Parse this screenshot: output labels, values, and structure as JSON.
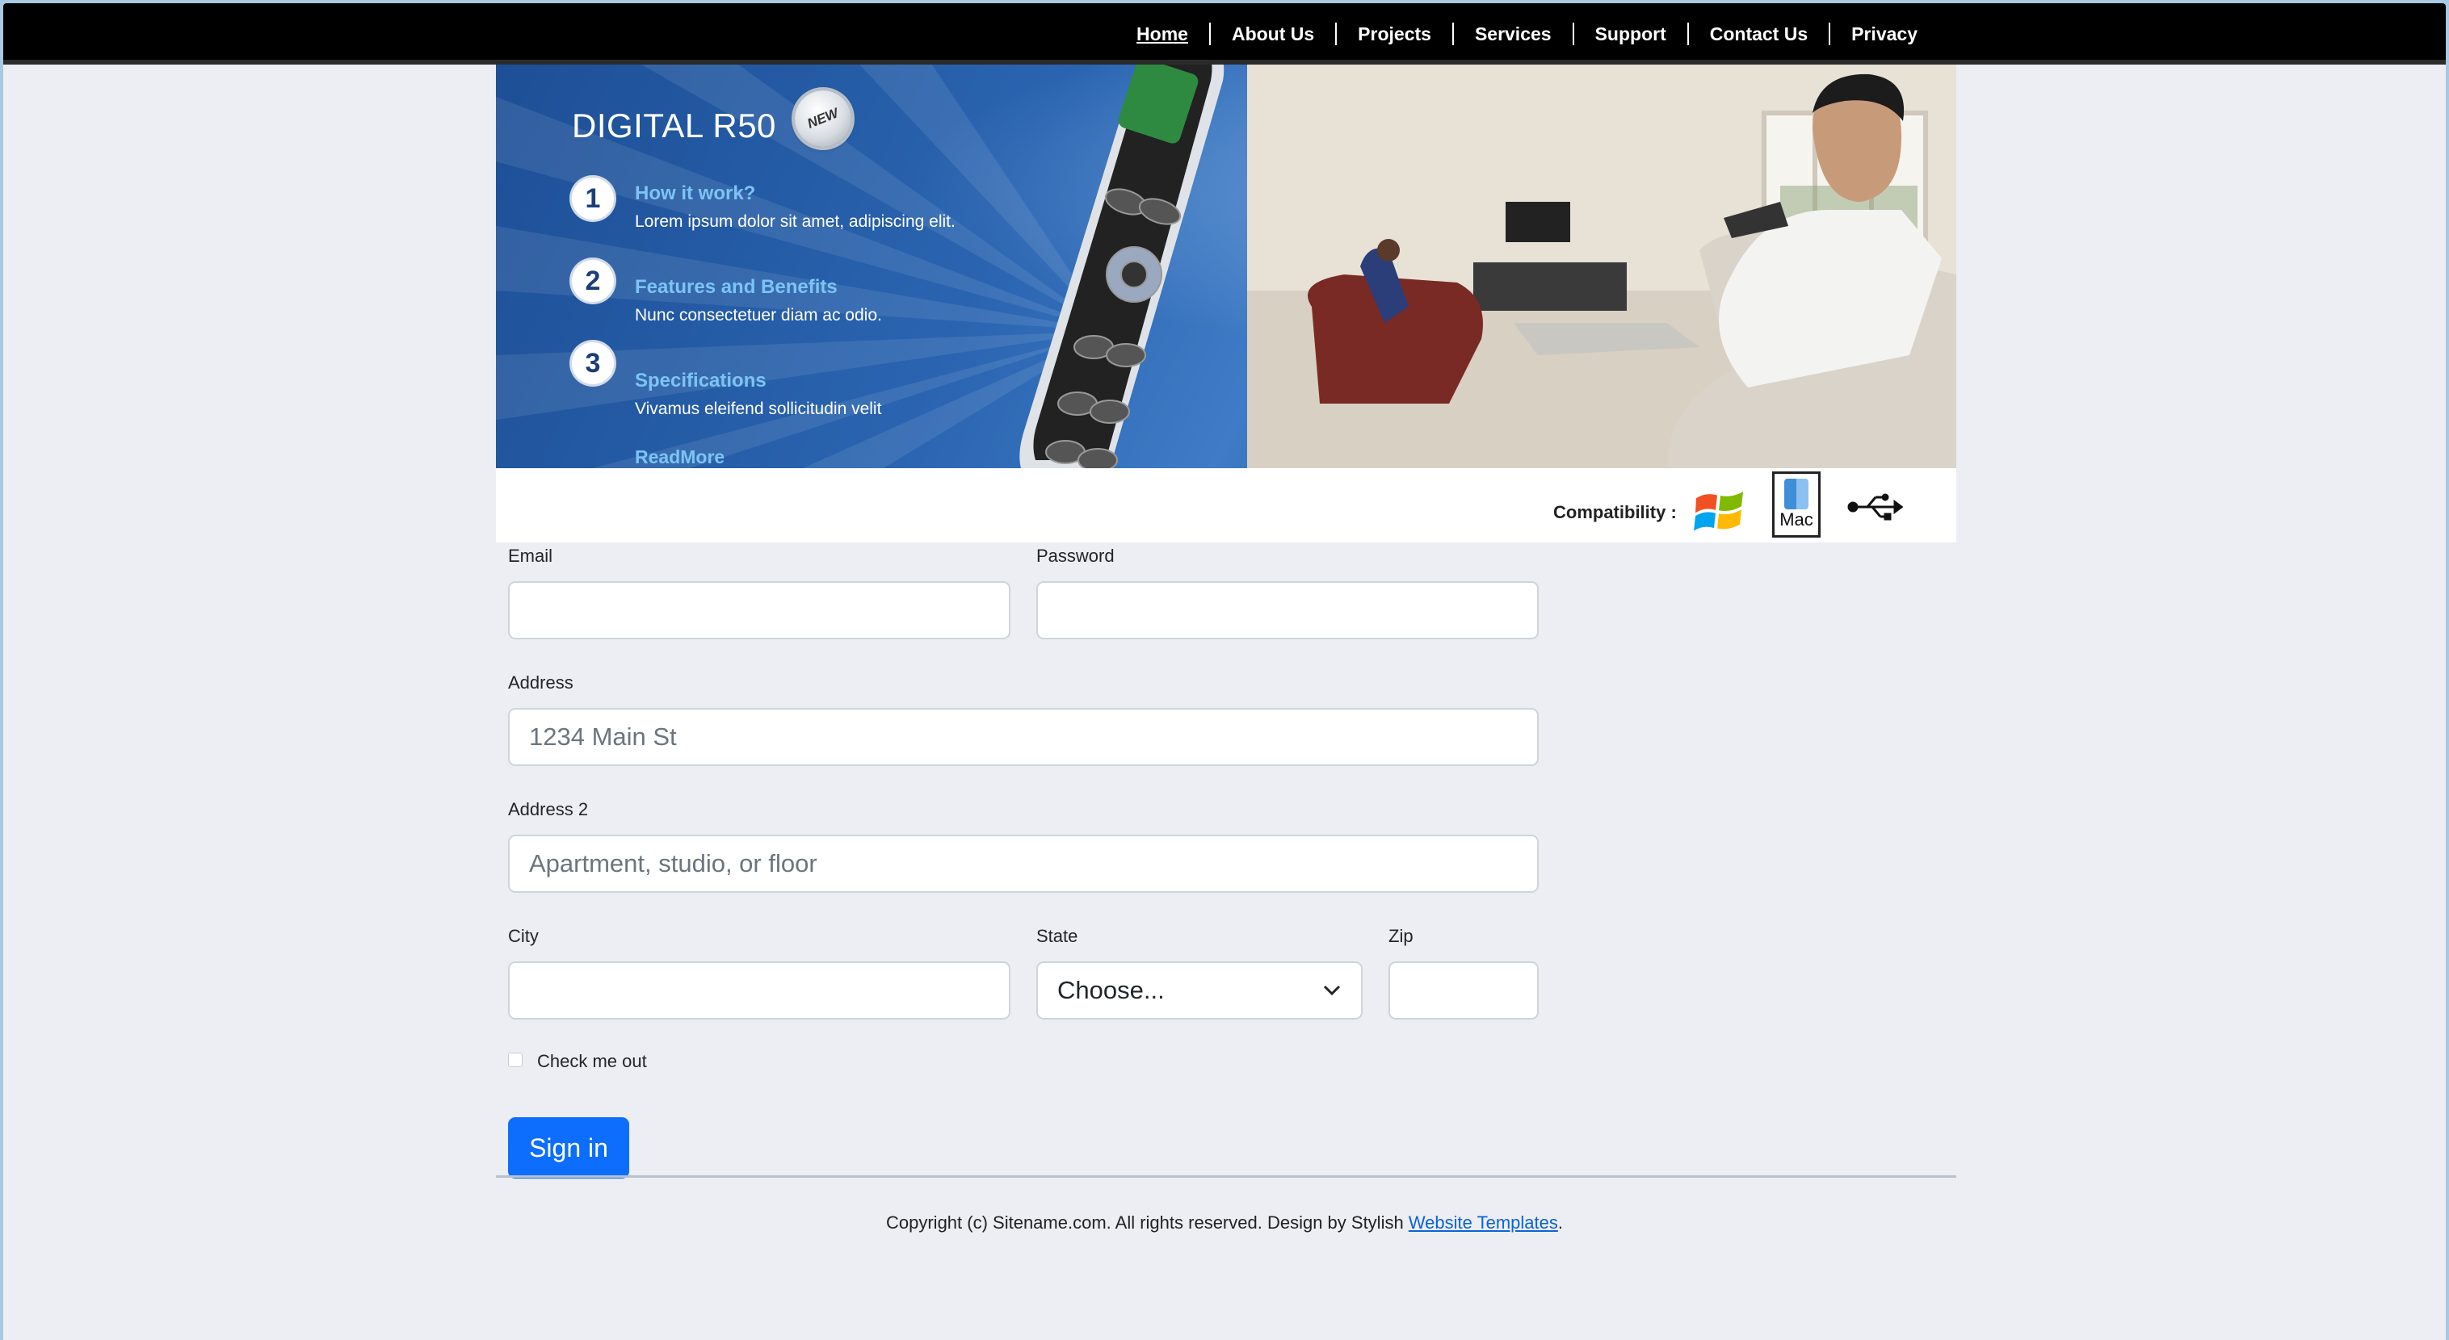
{
  "nav": {
    "items": [
      "Home",
      "About Us",
      "Projects",
      "Services",
      "Support",
      "Contact Us",
      "Privacy"
    ],
    "active": "Home"
  },
  "banner": {
    "title": "DIGITAL R50",
    "badge": "NEW",
    "steps": [
      {
        "num": "1",
        "title": "How it work?",
        "desc": "Lorem ipsum dolor sit amet, adipiscing elit."
      },
      {
        "num": "2",
        "title": "Features and Benefits",
        "desc": "Nunc consectetuer diam ac odio."
      },
      {
        "num": "3",
        "title": "Specifications",
        "desc": "Vivamus eleifend sollicitudin velit"
      }
    ],
    "readmore": "ReadMore"
  },
  "compat": {
    "label": "Compatibility :",
    "icons": [
      "windows-icon",
      "mac-icon",
      "usb-icon"
    ],
    "mac_text": "Mac"
  },
  "form": {
    "email_label": "Email",
    "password_label": "Password",
    "address_label": "Address",
    "address_placeholder": "1234 Main St",
    "address2_label": "Address 2",
    "address2_placeholder": "Apartment, studio, or floor",
    "city_label": "City",
    "state_label": "State",
    "state_value": "Choose...",
    "zip_label": "Zip",
    "check_label": "Check me out",
    "submit_label": "Sign in"
  },
  "footer": {
    "text": "Copyright (c) Sitename.com. All rights reserved. Design by Stylish",
    "link": "Website Templates",
    "end": "."
  },
  "colors": {
    "nav_bg": "#000000",
    "accent": "#0d6efd",
    "banner_blue": "#2a64b0",
    "step_title": "#7cc4f4"
  }
}
